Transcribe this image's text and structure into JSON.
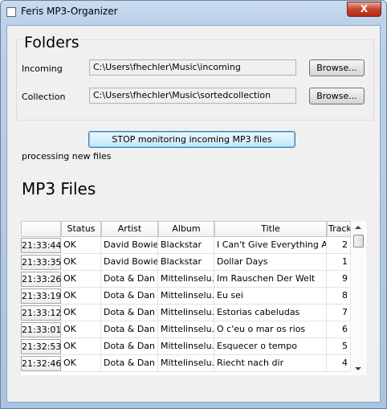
{
  "window": {
    "title": "Feris MP3-Organizer",
    "close_label": "X"
  },
  "folders": {
    "title": "Folders",
    "incoming_label": "Incoming",
    "incoming_path": "C:\\Users\\fhechler\\Music\\incoming",
    "collection_label": "Collection",
    "collection_path": "C:\\Users\\fhechler\\Music\\sortedcollection",
    "browse_label": "Browse..."
  },
  "monitor": {
    "button_label": "STOP monitoring incoming MP3 files",
    "status": "processing new files"
  },
  "mp3": {
    "title": "MP3 Files",
    "columns": [
      "",
      "Status",
      "Artist",
      "Album",
      "Title",
      "Track"
    ],
    "rows": [
      {
        "time": "21:33:44",
        "status": "OK",
        "artist": "David Bowie",
        "album": "Blackstar",
        "title": "I Can't Give Everything A...",
        "track": "2"
      },
      {
        "time": "21:33:35",
        "status": "OK",
        "artist": "David Bowie",
        "album": "Blackstar",
        "title": "Dollar Days",
        "track": "1"
      },
      {
        "time": "21:33:26",
        "status": "OK",
        "artist": "Dota & Dan",
        "album": "Mittelinselu...",
        "title": "Im Rauschen Der Welt",
        "track": "9"
      },
      {
        "time": "21:33:19",
        "status": "OK",
        "artist": "Dota & Dan",
        "album": "Mittelinselu...",
        "title": "Eu sei",
        "track": "8"
      },
      {
        "time": "21:33:12",
        "status": "OK",
        "artist": "Dota & Dan",
        "album": "Mittelinselu...",
        "title": "Estorias cabeludas",
        "track": "7"
      },
      {
        "time": "21:33:01",
        "status": "OK",
        "artist": "Dota & Dan",
        "album": "Mittelinselu...",
        "title": "O c'eu o mar os rios",
        "track": "6"
      },
      {
        "time": "21:32:53",
        "status": "OK",
        "artist": "Dota & Dan",
        "album": "Mittelinselu...",
        "title": "Esquecer o tempo",
        "track": "5"
      },
      {
        "time": "21:32:46",
        "status": "OK",
        "artist": "Dota & Dan",
        "album": "Mittelinselu...",
        "title": "Riecht nach dir",
        "track": "4"
      }
    ]
  },
  "icons": {
    "app": "app-icon",
    "close": "close-icon",
    "scroll_up": "arrow-up-icon",
    "scroll_down": "arrow-down-icon"
  },
  "colors": {
    "titlebar": "#bcd1ea",
    "close": "#c7442e",
    "accent": "#3c7fb1",
    "panel": "#f0f0f0"
  }
}
